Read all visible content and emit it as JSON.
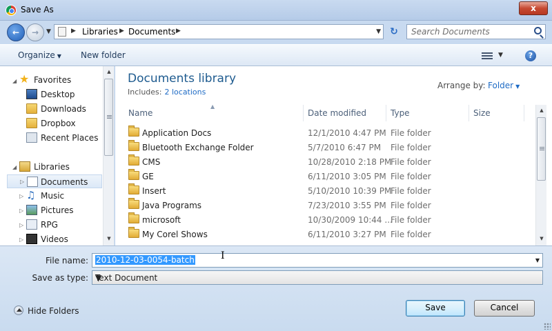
{
  "window": {
    "title": "Save As",
    "close_label": "x"
  },
  "address": {
    "crumbs": [
      "Libraries",
      "Documents"
    ],
    "search_placeholder": "Search Documents"
  },
  "toolbar": {
    "organize_label": "Organize",
    "new_folder_label": "New folder",
    "help_label": "?"
  },
  "sidebar": {
    "favorites_label": "Favorites",
    "favorites": [
      {
        "label": "Desktop",
        "icon": "desktop-icon"
      },
      {
        "label": "Downloads",
        "icon": "folder-icon"
      },
      {
        "label": "Dropbox",
        "icon": "folder-icon"
      },
      {
        "label": "Recent Places",
        "icon": "recent-places-icon"
      }
    ],
    "libraries_label": "Libraries",
    "libraries": [
      {
        "label": "Documents",
        "icon": "documents-icon",
        "selected": true
      },
      {
        "label": "Music",
        "icon": "music-icon"
      },
      {
        "label": "Pictures",
        "icon": "pictures-icon"
      },
      {
        "label": "RPG",
        "icon": "library-icon"
      },
      {
        "label": "Videos",
        "icon": "videos-icon"
      }
    ]
  },
  "library": {
    "title": "Documents library",
    "includes_label": "Includes:",
    "includes_link": "2 locations",
    "arrange_label": "Arrange by:",
    "arrange_value": "Folder"
  },
  "columns": {
    "name": "Name",
    "date": "Date modified",
    "type": "Type",
    "size": "Size"
  },
  "files": [
    {
      "name": "Application Docs",
      "date": "12/1/2010 4:47 PM",
      "type": "File folder"
    },
    {
      "name": "Bluetooth Exchange Folder",
      "date": "5/7/2010 6:47 PM",
      "type": "File folder"
    },
    {
      "name": "CMS",
      "date": "10/28/2010 2:18 PM",
      "type": "File folder"
    },
    {
      "name": "GE",
      "date": "6/11/2010 3:05 PM",
      "type": "File folder"
    },
    {
      "name": "Insert",
      "date": "5/10/2010 10:39 PM",
      "type": "File folder"
    },
    {
      "name": "Java Programs",
      "date": "7/23/2010 3:55 PM",
      "type": "File folder"
    },
    {
      "name": "microsoft",
      "date": "10/30/2009 10:44 ...",
      "type": "File folder"
    },
    {
      "name": "My Corel Shows",
      "date": "6/11/2010 3:27 PM",
      "type": "File folder"
    }
  ],
  "form": {
    "file_name_label": "File name:",
    "file_name_value": "2010-12-03-0054-batch",
    "save_type_label": "Save as type:",
    "save_type_value": "Text Document"
  },
  "footer": {
    "hide_folders_label": "Hide Folders",
    "save_label": "Save",
    "cancel_label": "Cancel"
  },
  "colors": {
    "title_blue": "#1e5b8f",
    "link_blue": "#1e6bc5",
    "selection": "#3399ff",
    "close_red": "#c74a33"
  }
}
